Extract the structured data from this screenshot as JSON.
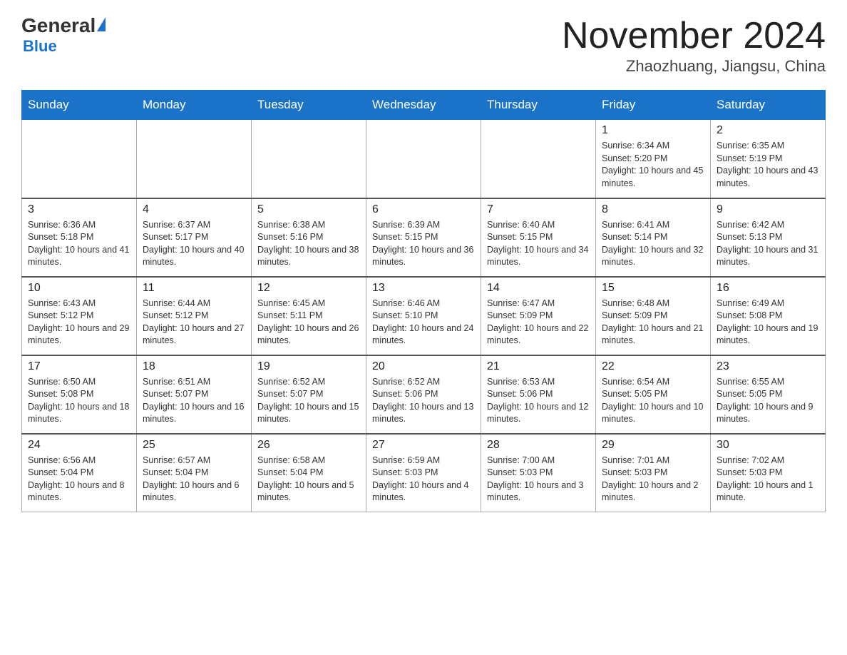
{
  "header": {
    "logo_general": "General",
    "logo_blue": "Blue",
    "month_title": "November 2024",
    "location": "Zhaozhuang, Jiangsu, China"
  },
  "weekdays": [
    "Sunday",
    "Monday",
    "Tuesday",
    "Wednesday",
    "Thursday",
    "Friday",
    "Saturday"
  ],
  "weeks": [
    [
      {
        "day": "",
        "info": ""
      },
      {
        "day": "",
        "info": ""
      },
      {
        "day": "",
        "info": ""
      },
      {
        "day": "",
        "info": ""
      },
      {
        "day": "",
        "info": ""
      },
      {
        "day": "1",
        "info": "Sunrise: 6:34 AM\nSunset: 5:20 PM\nDaylight: 10 hours and 45 minutes."
      },
      {
        "day": "2",
        "info": "Sunrise: 6:35 AM\nSunset: 5:19 PM\nDaylight: 10 hours and 43 minutes."
      }
    ],
    [
      {
        "day": "3",
        "info": "Sunrise: 6:36 AM\nSunset: 5:18 PM\nDaylight: 10 hours and 41 minutes."
      },
      {
        "day": "4",
        "info": "Sunrise: 6:37 AM\nSunset: 5:17 PM\nDaylight: 10 hours and 40 minutes."
      },
      {
        "day": "5",
        "info": "Sunrise: 6:38 AM\nSunset: 5:16 PM\nDaylight: 10 hours and 38 minutes."
      },
      {
        "day": "6",
        "info": "Sunrise: 6:39 AM\nSunset: 5:15 PM\nDaylight: 10 hours and 36 minutes."
      },
      {
        "day": "7",
        "info": "Sunrise: 6:40 AM\nSunset: 5:15 PM\nDaylight: 10 hours and 34 minutes."
      },
      {
        "day": "8",
        "info": "Sunrise: 6:41 AM\nSunset: 5:14 PM\nDaylight: 10 hours and 32 minutes."
      },
      {
        "day": "9",
        "info": "Sunrise: 6:42 AM\nSunset: 5:13 PM\nDaylight: 10 hours and 31 minutes."
      }
    ],
    [
      {
        "day": "10",
        "info": "Sunrise: 6:43 AM\nSunset: 5:12 PM\nDaylight: 10 hours and 29 minutes."
      },
      {
        "day": "11",
        "info": "Sunrise: 6:44 AM\nSunset: 5:12 PM\nDaylight: 10 hours and 27 minutes."
      },
      {
        "day": "12",
        "info": "Sunrise: 6:45 AM\nSunset: 5:11 PM\nDaylight: 10 hours and 26 minutes."
      },
      {
        "day": "13",
        "info": "Sunrise: 6:46 AM\nSunset: 5:10 PM\nDaylight: 10 hours and 24 minutes."
      },
      {
        "day": "14",
        "info": "Sunrise: 6:47 AM\nSunset: 5:09 PM\nDaylight: 10 hours and 22 minutes."
      },
      {
        "day": "15",
        "info": "Sunrise: 6:48 AM\nSunset: 5:09 PM\nDaylight: 10 hours and 21 minutes."
      },
      {
        "day": "16",
        "info": "Sunrise: 6:49 AM\nSunset: 5:08 PM\nDaylight: 10 hours and 19 minutes."
      }
    ],
    [
      {
        "day": "17",
        "info": "Sunrise: 6:50 AM\nSunset: 5:08 PM\nDaylight: 10 hours and 18 minutes."
      },
      {
        "day": "18",
        "info": "Sunrise: 6:51 AM\nSunset: 5:07 PM\nDaylight: 10 hours and 16 minutes."
      },
      {
        "day": "19",
        "info": "Sunrise: 6:52 AM\nSunset: 5:07 PM\nDaylight: 10 hours and 15 minutes."
      },
      {
        "day": "20",
        "info": "Sunrise: 6:52 AM\nSunset: 5:06 PM\nDaylight: 10 hours and 13 minutes."
      },
      {
        "day": "21",
        "info": "Sunrise: 6:53 AM\nSunset: 5:06 PM\nDaylight: 10 hours and 12 minutes."
      },
      {
        "day": "22",
        "info": "Sunrise: 6:54 AM\nSunset: 5:05 PM\nDaylight: 10 hours and 10 minutes."
      },
      {
        "day": "23",
        "info": "Sunrise: 6:55 AM\nSunset: 5:05 PM\nDaylight: 10 hours and 9 minutes."
      }
    ],
    [
      {
        "day": "24",
        "info": "Sunrise: 6:56 AM\nSunset: 5:04 PM\nDaylight: 10 hours and 8 minutes."
      },
      {
        "day": "25",
        "info": "Sunrise: 6:57 AM\nSunset: 5:04 PM\nDaylight: 10 hours and 6 minutes."
      },
      {
        "day": "26",
        "info": "Sunrise: 6:58 AM\nSunset: 5:04 PM\nDaylight: 10 hours and 5 minutes."
      },
      {
        "day": "27",
        "info": "Sunrise: 6:59 AM\nSunset: 5:03 PM\nDaylight: 10 hours and 4 minutes."
      },
      {
        "day": "28",
        "info": "Sunrise: 7:00 AM\nSunset: 5:03 PM\nDaylight: 10 hours and 3 minutes."
      },
      {
        "day": "29",
        "info": "Sunrise: 7:01 AM\nSunset: 5:03 PM\nDaylight: 10 hours and 2 minutes."
      },
      {
        "day": "30",
        "info": "Sunrise: 7:02 AM\nSunset: 5:03 PM\nDaylight: 10 hours and 1 minute."
      }
    ]
  ]
}
